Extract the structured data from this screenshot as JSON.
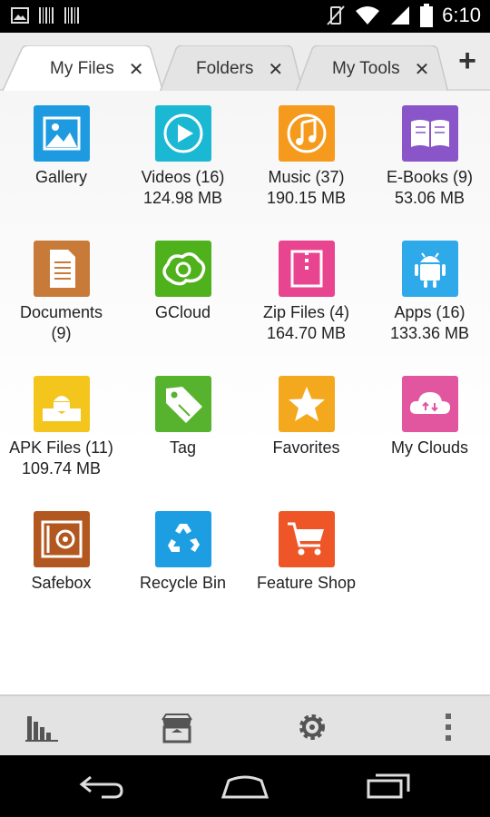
{
  "status_bar": {
    "time": "6:10",
    "left_icons": [
      "gallery-notification-icon",
      "barcode-icon",
      "barcode-icon"
    ],
    "right_icons": [
      "vibrate-mute-icon",
      "wifi-icon",
      "signal-icon",
      "battery-icon"
    ]
  },
  "tabs": [
    {
      "label": "My Files",
      "active": true
    },
    {
      "label": "Folders",
      "active": false
    },
    {
      "label": "My Tools",
      "active": false
    }
  ],
  "tab_close_glyph": "✕",
  "tab_add_glyph": "+",
  "items": [
    {
      "label": "Gallery",
      "size": "",
      "icon": "gallery-icon",
      "color": "#1e9be0"
    },
    {
      "label": "Videos (16)",
      "size": "124.98 MB",
      "icon": "video-icon",
      "color": "#1bb8d3"
    },
    {
      "label": "Music (37)",
      "size": "190.15 MB",
      "icon": "music-icon",
      "color": "#f59a1c"
    },
    {
      "label": "E-Books (9)",
      "size": "53.06 MB",
      "icon": "book-icon",
      "color": "#8a55c9"
    },
    {
      "label": "Documents",
      "size": "(9)",
      "icon": "document-icon",
      "color": "#c87a38"
    },
    {
      "label": "GCloud",
      "size": "",
      "icon": "gcloud-icon",
      "color": "#4fb21d"
    },
    {
      "label": "Zip Files (4)",
      "size": "164.70 MB",
      "icon": "zip-icon",
      "color": "#e9448f"
    },
    {
      "label": "Apps (16)",
      "size": "133.36 MB",
      "icon": "android-icon",
      "color": "#2ea9ea"
    },
    {
      "label": "APK Files (11)",
      "size": "109.74 MB",
      "icon": "apk-icon",
      "color": "#f4c51c"
    },
    {
      "label": "Tag",
      "size": "",
      "icon": "tag-icon",
      "color": "#57b32d"
    },
    {
      "label": "Favorites",
      "size": "",
      "icon": "star-icon",
      "color": "#f4a81d"
    },
    {
      "label": "My Clouds",
      "size": "",
      "icon": "cloud-icon",
      "color": "#e2559f"
    },
    {
      "label": "Safebox",
      "size": "",
      "icon": "safebox-icon",
      "color": "#b2571f"
    },
    {
      "label": "Recycle Bin",
      "size": "",
      "icon": "recycle-icon",
      "color": "#1d9ee2"
    },
    {
      "label": "Feature Shop",
      "size": "",
      "icon": "cart-icon",
      "color": "#ee5628"
    }
  ],
  "toolbar": {
    "buttons": [
      "analysis-icon",
      "store-icon",
      "settings-icon",
      "overflow-menu-icon"
    ]
  },
  "navbar": {
    "buttons": [
      "back-icon",
      "home-icon",
      "recents-icon"
    ]
  }
}
